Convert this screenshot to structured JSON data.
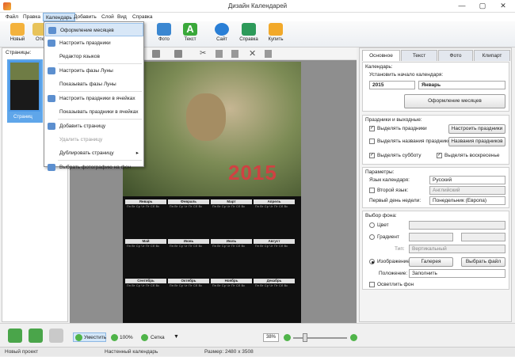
{
  "window": {
    "title": "Дизайн Календарей",
    "controls": [
      "—",
      "▢",
      "✕"
    ]
  },
  "menu": [
    "Файл",
    "Правка",
    "Календарь",
    "Добавить",
    "Слой",
    "Вид",
    "Справка"
  ],
  "toolbar": [
    {
      "label": "Новый",
      "icon": "new-document-icon",
      "color": "#f4b23c"
    },
    {
      "label": "Отк",
      "icon": "open-folder-icon",
      "color": "#e8c35a"
    },
    {
      "label": "Фото",
      "icon": "photo-icon",
      "color": "#3b87d1"
    },
    {
      "label": "Текст",
      "icon": "text-icon",
      "color": "#3aa83a"
    },
    {
      "label": "Сайт",
      "icon": "globe-icon",
      "color": "#2a7fd6"
    },
    {
      "label": "Справка",
      "icon": "help-icon",
      "color": "#2d9a5a"
    },
    {
      "label": "Купить",
      "icon": "cart-icon",
      "color": "#f2a92a"
    }
  ],
  "dropdown": [
    {
      "label": "Оформление месяцев",
      "icon": "months-design-icon",
      "state": "highlighted"
    },
    {
      "label": "Настроить праздники",
      "icon": "holidays-icon",
      "state": "normal"
    },
    {
      "label": "Редактор языков",
      "icon": "",
      "state": "normal"
    },
    {
      "label": "Настроить фазы Луны",
      "icon": "moon-icon",
      "state": "normal"
    },
    {
      "label": "Показывать фазы Луны",
      "icon": "",
      "state": "normal"
    },
    {
      "label": "Настроить праздники в ячейках",
      "icon": "cell-holidays-icon",
      "state": "normal"
    },
    {
      "label": "Показывать праздники в ячейках",
      "icon": "",
      "state": "normal"
    },
    {
      "label": "Добавить страницу",
      "icon": "add-page-icon",
      "state": "normal"
    },
    {
      "label": "Удалить страницу",
      "icon": "",
      "state": "disabled"
    },
    {
      "label": "Дублировать страницу",
      "icon": "",
      "state": "submenu"
    },
    {
      "label": "Выбрать фотографию на фон",
      "icon": "background-photo-icon",
      "state": "normal"
    }
  ],
  "left_panel": {
    "header": "Страницы:",
    "page_label": "Страниц"
  },
  "calendar_preview": {
    "year": "2015",
    "weekdays": "Пн Вт Ср Чт Пт Сб Вс",
    "months": [
      "Январь",
      "Февраль",
      "Март",
      "Апрель",
      "Май",
      "Июнь",
      "Июль",
      "Август",
      "Сентябрь",
      "Октябрь",
      "Ноябрь",
      "Декабрь"
    ]
  },
  "right_panel": {
    "tabs": [
      "Основное",
      "Текст",
      "Фото",
      "Клипарт"
    ],
    "calendar_group": {
      "title": "Календарь:",
      "start_label": "Установить начало календаря:",
      "year": "2015",
      "month": "Январь",
      "design_button": "Оформление месяцев"
    },
    "holidays_group": {
      "title": "Праздники и выходные:",
      "highlight_holidays": "Выделять праздники",
      "configure_holidays": "Настроить праздники",
      "highlight_names": "Выделять названия праздников",
      "holiday_names": "Названия праздников",
      "highlight_saturday": "Выделять субботу",
      "highlight_sunday": "Выделять воскресенье"
    },
    "params_group": {
      "title": "Параметры:",
      "language_label": "Язык календаря:",
      "language_value": "Русский",
      "second_lang_label": "Второй язык:",
      "second_lang_value": "Английский",
      "first_day_label": "Первый день недели:",
      "first_day_value": "Понедельник (Европа)"
    },
    "background_group": {
      "title": "Выбор фона:",
      "color_label": "Цвет",
      "gradient_label": "Градиент",
      "type_label": "Тип:",
      "type_value": "Вертикальный",
      "image_label": "Изображение",
      "gallery_button": "Галерея",
      "choose_file_button": "Выбрать файл",
      "position_label": "Положение:",
      "position_value": "Заполнить",
      "brighten_label": "Осветлить фон"
    }
  },
  "bottom_bar": {
    "fit": "Уместить",
    "zoom100": "100%",
    "grid": "Сетка",
    "zoom": "38%"
  },
  "status": {
    "project": "Новый проект",
    "type": "Настенный календарь",
    "size": "Размер: 2480 x 3508"
  }
}
